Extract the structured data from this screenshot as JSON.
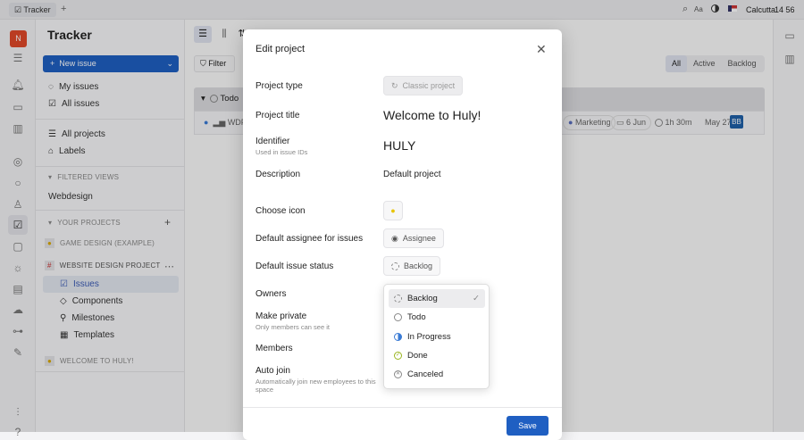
{
  "topbar": {
    "tab": "Tracker",
    "add": "+",
    "font": "Aa",
    "location": "Calcutta",
    "time": "14 56"
  },
  "rail": {
    "avatar": "N"
  },
  "sidebar": {
    "title": "Tracker",
    "new_issue": "New issue",
    "my_issues": "My issues",
    "all_issues": "All issues",
    "all_projects": "All projects",
    "labels": "Labels",
    "filtered_views": "FILTERED VIEWS",
    "webdesign": "Webdesign",
    "your_projects": "YOUR PROJECTS",
    "projects": [
      "GAME DESIGN (EXAMPLE)",
      "WEBSITE DESIGN PROJECT",
      "WELCOME TO HULY!"
    ],
    "sub_items": [
      "Issues",
      "Components",
      "Milestones",
      "Templates"
    ]
  },
  "main": {
    "filter": "Filter",
    "view_tabs": [
      "All",
      "Active",
      "Backlog"
    ],
    "group": "Todo",
    "issue_id": "WDP",
    "tag": "Marketing",
    "due": "6 Jun",
    "estimate": "1h 30m",
    "date": "May 27",
    "assignee": "BB"
  },
  "modal": {
    "title": "Edit project",
    "rows": {
      "type_label": "Project type",
      "type_value": "Classic project",
      "title_label": "Project title",
      "title_value": "Welcome to Huly!",
      "identifier_label": "Identifier",
      "identifier_sub": "Used in issue IDs",
      "identifier_value": "HULY",
      "description_label": "Description",
      "description_value": "Default project",
      "icon_label": "Choose icon",
      "assignee_label": "Default assignee for issues",
      "assignee_value": "Assignee",
      "status_label": "Default issue status",
      "status_value": "Backlog",
      "owners_label": "Owners",
      "private_label": "Make private",
      "private_sub": "Only members can see it",
      "members_label": "Members",
      "autojoin_label": "Auto join",
      "autojoin_sub": "Automatically join new employees to this space"
    },
    "save": "Save"
  },
  "dropdown": {
    "items": [
      "Backlog",
      "Todo",
      "In Progress",
      "Done",
      "Canceled"
    ],
    "selected": "Backlog"
  },
  "colors": {
    "accent": "#1f5fc2",
    "avatar": "#e0492a"
  }
}
